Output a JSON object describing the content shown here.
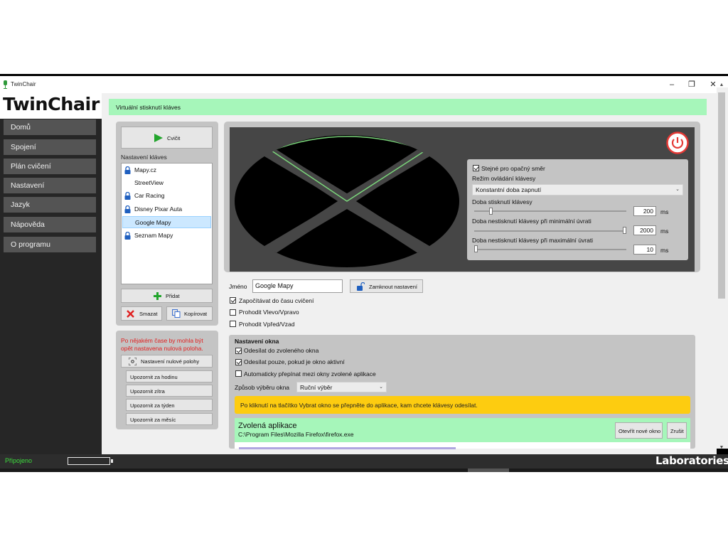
{
  "window": {
    "title": "TwinChair",
    "minimize": "–",
    "maximize": "❐",
    "close": "✕"
  },
  "logo": "TwinChair",
  "sidebar": {
    "items": [
      {
        "label": "Domů"
      },
      {
        "label": "Spojení"
      },
      {
        "label": "Plán cvičení"
      },
      {
        "label": "Nastavení"
      },
      {
        "label": "Jazyk"
      },
      {
        "label": "Nápověda"
      },
      {
        "label": "O programu"
      }
    ]
  },
  "header": {
    "title": "Virtuální stisknutí kláves"
  },
  "left": {
    "train_button": "Cvičit",
    "key_settings_label": "Nastavení kláves",
    "presets": [
      {
        "name": "Mapy.cz",
        "locked": true
      },
      {
        "name": "StreetView",
        "locked": false
      },
      {
        "name": "Car Racing",
        "locked": true
      },
      {
        "name": "Disney Pixar Auta",
        "locked": true
      },
      {
        "name": "Google Mapy",
        "locked": false,
        "selected": true
      },
      {
        "name": "Seznam Mapy",
        "locked": true
      }
    ],
    "add_button": "Přidat",
    "delete_button": "Smazat",
    "copy_button": "Kopírovat",
    "reset_warning": "Po nějakém čase by mohla být opět nastavena nulová poloha.",
    "reset_button": "Nastavení nulové polohy",
    "remind_hour": "Upozornit za hodinu",
    "remind_tomorrow": "Upozornit zítra",
    "remind_week": "Upozornit za týden",
    "remind_month": "Upozornit za měsíc"
  },
  "key_config": {
    "same_opposite_label": "Stejné pro opačný směr",
    "same_opposite_checked": true,
    "mode_label": "Režim ovládání klávesy",
    "mode_value": "Konstantní doba zapnutí",
    "press_time_label": "Doba stisknutí klávesy",
    "press_time_value": "200",
    "press_time_fraction": 0.1,
    "min_release_label": "Doba nestisknutí klávesy při minimální úvrati",
    "min_release_value": "2000",
    "min_release_fraction": 1.0,
    "max_release_label": "Doba nestisknutí klávesy při maximální úvrati",
    "max_release_value": "10",
    "max_release_fraction": 0.0,
    "unit": "ms"
  },
  "name_row": {
    "label": "Jméno",
    "value": "Google Mapy",
    "lock_button": "Zamknout nastavení"
  },
  "options": {
    "count_time_label": "Započítávat do času cvičení",
    "count_time_checked": true,
    "swap_lr_label": "Prohodit Vlevo/Vpravo",
    "swap_lr_checked": false,
    "swap_fb_label": "Prohodit Vpřed/Vzad",
    "swap_fb_checked": false
  },
  "window_settings": {
    "title": "Nastavení okna",
    "send_selected_label": "Odesílat do zvoleného okna",
    "send_selected_checked": true,
    "send_active_label": "Odesílat pouze, pokud je okno aktivní",
    "send_active_checked": true,
    "auto_switch_label": "Automaticky přepínat mezi okny zvolené aplikace",
    "auto_switch_checked": false,
    "selection_label": "Způsob výběru okna",
    "selection_value": "Ruční výběr",
    "info_text": "Po kliknutí na tlačítko Vybrat okno se přepněte do aplikace, kam chcete klávesy odesílat.",
    "app_title": "Zvolená aplikace",
    "app_path": "C:\\Program Files\\Mozilla Firefox\\firefox.exe",
    "open_new_window": "Otevřít nové okno",
    "cancel": "Zrušit"
  },
  "status": {
    "connection": "Připojeno",
    "brand": "Laboratories"
  },
  "colors": {
    "accent_green": "#a6f6ba",
    "warning_yellow": "#fdcc10",
    "status_green": "#3ddc3d",
    "power_red": "#e53935"
  }
}
